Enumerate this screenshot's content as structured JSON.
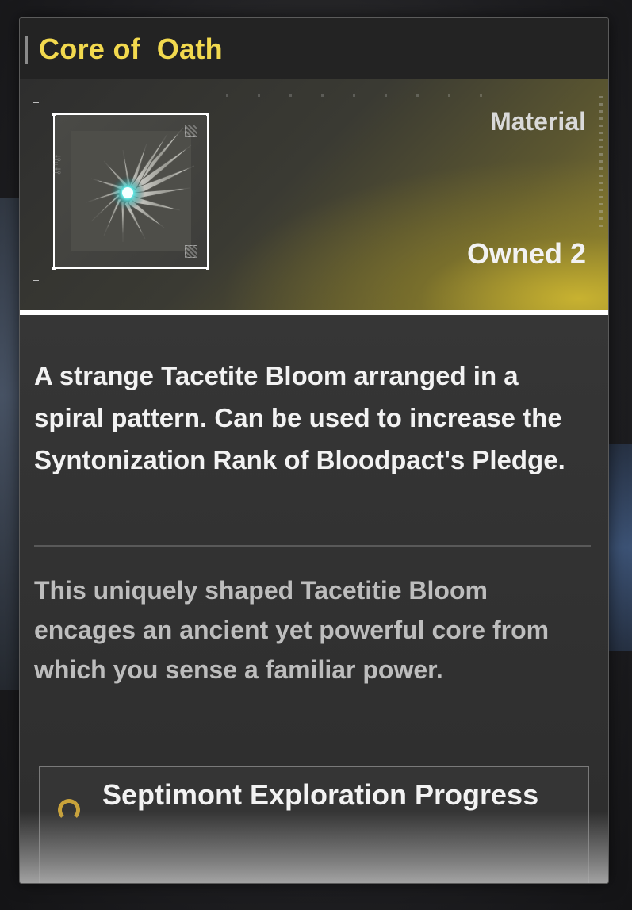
{
  "item": {
    "name": "Core of  Oath",
    "category": "Material",
    "owned_label": "Owned",
    "owned_count": "2",
    "icon": "tacetite-bloom-spiral-icon",
    "rarity_color": "#ffffff",
    "title_color": "#f2d94e"
  },
  "description": "A strange Tacetite Bloom arranged in a spiral pattern. Can be used to increase the Syntonization Rank of Bloodpact's Pledge.",
  "lore": "This uniquely shaped Tacetitie Bloom encages an ancient yet powerful core from which you sense a familiar power.",
  "source": {
    "label": "Septimont Exploration Progress",
    "icon": "exploration-pin-icon"
  }
}
